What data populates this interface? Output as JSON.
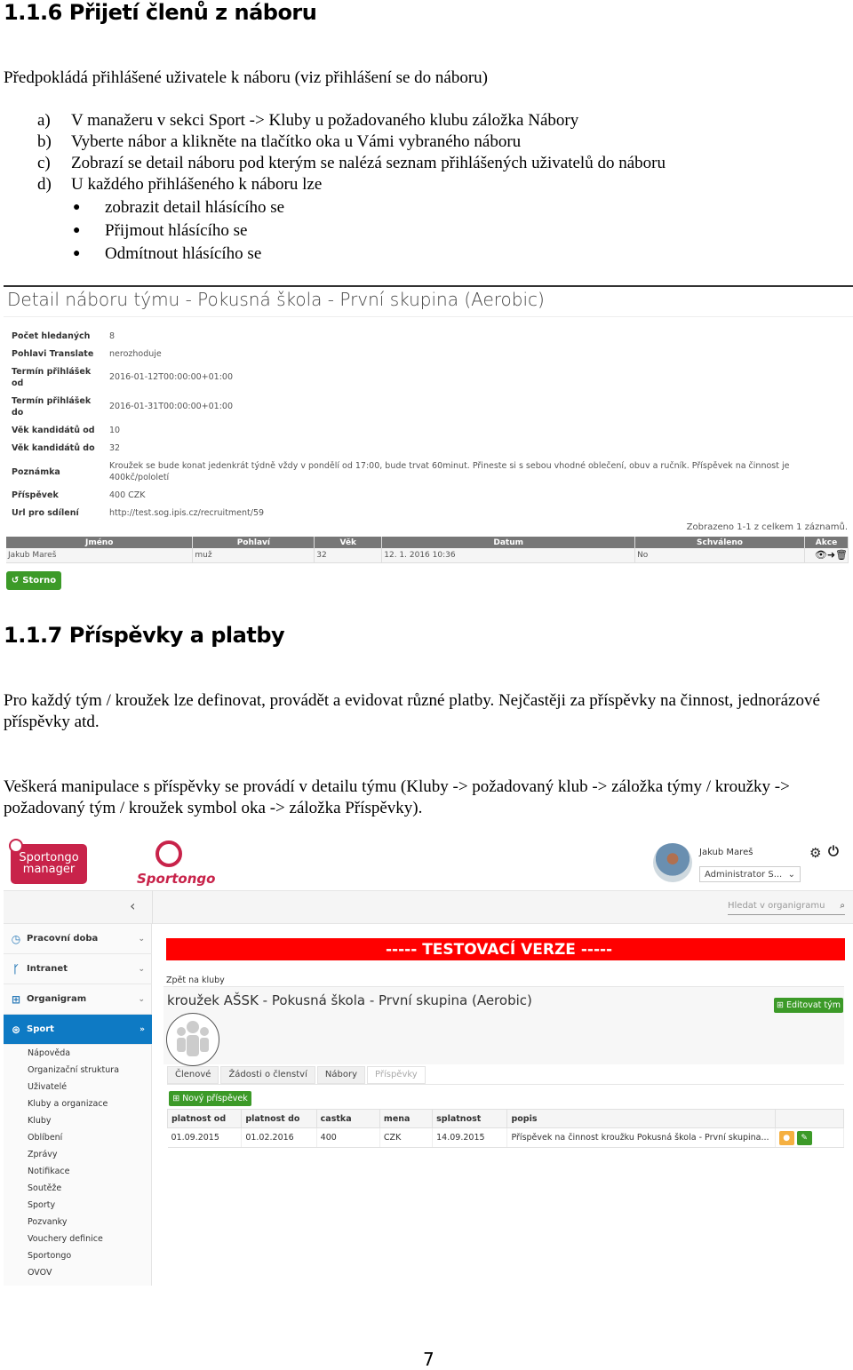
{
  "section1": {
    "heading": "1.1.6  Přijetí členů z náboru",
    "intro": "Předpokládá přihlášené uživatele k náboru (viz přihlášení se do náboru)",
    "steps": [
      {
        "marker": "a)",
        "text": "V manažeru v sekci Sport -> Kluby u požadovaného klubu záložka Nábory"
      },
      {
        "marker": "b)",
        "text": "Vyberte nábor a klikněte na tlačítko oka u Vámi vybraného náboru"
      },
      {
        "marker": "c)",
        "text": "Zobrazí se detail náboru pod kterým se nalézá seznam přihlášených uživatelů do náboru"
      },
      {
        "marker": "d)",
        "text": "U každého přihlášeného k náboru lze"
      }
    ],
    "bullets": [
      "zobrazit detail hlásícího se",
      "Přijmout hlásícího se",
      "Odmítnout hlásícího se"
    ]
  },
  "screenshot1": {
    "title": "Detail náboru týmu - Pokusná škola - První skupina (Aerobic)",
    "fields": [
      {
        "label": "Počet hledaných",
        "value": "8"
      },
      {
        "label": "Pohlavi Translate",
        "value": "nerozhoduje"
      },
      {
        "label": "Termín přihlášek od",
        "value": "2016-01-12T00:00:00+01:00"
      },
      {
        "label": "Termín přihlášek do",
        "value": "2016-01-31T00:00:00+01:00"
      },
      {
        "label": "Věk kandidátů od",
        "value": "10"
      },
      {
        "label": "Věk kandidátů do",
        "value": "32"
      },
      {
        "label": "Poznámka",
        "value": "Kroužek se bude konat jedenkrát týdně vždy v pondělí od 17:00, bude trvat 60minut. Přineste si s sebou vhodné oblečení, obuv a ručník. Příspěvek na činnost je 400kč/pololetí"
      },
      {
        "label": "Příspěvek",
        "value": "400 CZK"
      },
      {
        "label": "Url pro sdílení",
        "value": "http://test.sog.ipis.cz/recruitment/59"
      }
    ],
    "record_count": "Zobrazeno 1-1 z celkem 1 záznamů.",
    "table": {
      "headers": [
        "Jméno",
        "Pohlaví",
        "Věk",
        "Datum",
        "Schváleno",
        "Akce"
      ],
      "rows": [
        [
          "Jakub Mareš",
          "muž",
          "32",
          "12. 1. 2016 10:36",
          "No"
        ]
      ]
    },
    "action_icons": [
      "eye-icon",
      "sign-in-icon",
      "trash-icon"
    ],
    "storno_label": "Storno"
  },
  "section2": {
    "heading": "1.1.7  Příspěvky a platby",
    "para1": "Pro každý tým / kroužek lze definovat, provádět a evidovat různé platby. Nejčastěji za příspěvky na činnost, jednorázové příspěvky atd.",
    "para2": "Veškerá manipulace s příspěvky se provádí v detailu týmu (Kluby -> požadovaný klub -> záložka týmy / kroužky -> požadovaný tým / kroužek symbol oka -> záložka Příspěvky)."
  },
  "screenshot2": {
    "logo_manager_line1": "Sportongo",
    "logo_manager_line2": "manager",
    "logo_sportongo": "Sportongo",
    "user_name": "Jakub Mareš",
    "role": "Administrator S...",
    "search_placeholder": "Hledat v organigramu",
    "sidebar": [
      {
        "label": "Pracovní doba",
        "icon": "clock-icon"
      },
      {
        "label": "Intranet",
        "icon": "fork-icon"
      },
      {
        "label": "Organigram",
        "icon": "sitemap-icon"
      },
      {
        "label": "Sport",
        "icon": "ball-icon",
        "active": true
      }
    ],
    "submenu": [
      "Nápověda",
      "Organizační struktura",
      "Uživatelé",
      "Kluby a organizace",
      "Kluby",
      "Oblíbení",
      "Zprávy",
      "Notifikace",
      "Soutěže",
      "Sporty",
      "Pozvanky",
      "Vouchery definice",
      "Sportongo",
      "OVOV"
    ],
    "banner": "----- TESTOVACÍ VERZE -----",
    "back_link": "Zpět na kluby",
    "team_title": "kroužek AŠSK - Pokusná škola - První skupina (Aerobic)",
    "edit_team": "Editovat tým",
    "tabs": [
      "Členové",
      "Žádosti o členství",
      "Nábory",
      "Příspěvky"
    ],
    "active_tab": "Příspěvky",
    "new_contribution": "Nový příspěvek",
    "table": {
      "headers": [
        "platnost od",
        "platnost do",
        "castka",
        "mena",
        "splatnost",
        "popis",
        ""
      ],
      "rows": [
        [
          "01.09.2015",
          "01.02.2016",
          "400",
          "CZK",
          "14.09.2015",
          "Příspěvek na činnost kroužku Pokusná škola - První skupina..."
        ]
      ]
    }
  },
  "page_number": "7"
}
